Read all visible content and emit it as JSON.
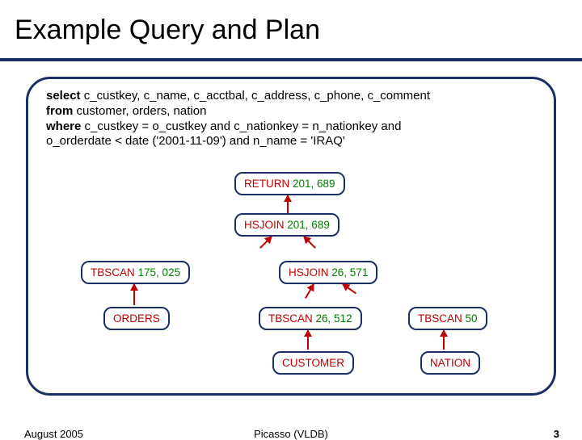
{
  "title": "Example Query and Plan",
  "query": {
    "kw_select": "select",
    "select_cols": "  c_custkey, c_name, c_acctbal,  c_address, c_phone, c_comment",
    "kw_from": "from",
    "from_tables": "    customer, orders, nation",
    "kw_where": "where",
    "where1": "  c_custkey = o_custkey  and  c_nationkey = n_nationkey  and",
    "where2": "             o_orderdate <  date ('2001-11-09')  and  n_name = 'IRAQ'"
  },
  "nodes": {
    "return": {
      "op": "RETURN",
      "card": "201, 689"
    },
    "hsjoin1": {
      "op": "HSJOIN",
      "card": "201, 689"
    },
    "tbscanO": {
      "op": "TBSCAN",
      "card": "175, 025"
    },
    "orders": {
      "op": "ORDERS",
      "card": ""
    },
    "hsjoin2": {
      "op": "HSJOIN",
      "card": "26, 571"
    },
    "tbscanC": {
      "op": "TBSCAN",
      "card": "26, 512"
    },
    "customer": {
      "op": "CUSTOMER",
      "card": ""
    },
    "tbscanN": {
      "op": "TBSCAN",
      "card": "50"
    },
    "nation": {
      "op": "NATION",
      "card": ""
    }
  },
  "footer": {
    "left": "August 2005",
    "center": "Picasso (VLDB)",
    "right": "3"
  }
}
